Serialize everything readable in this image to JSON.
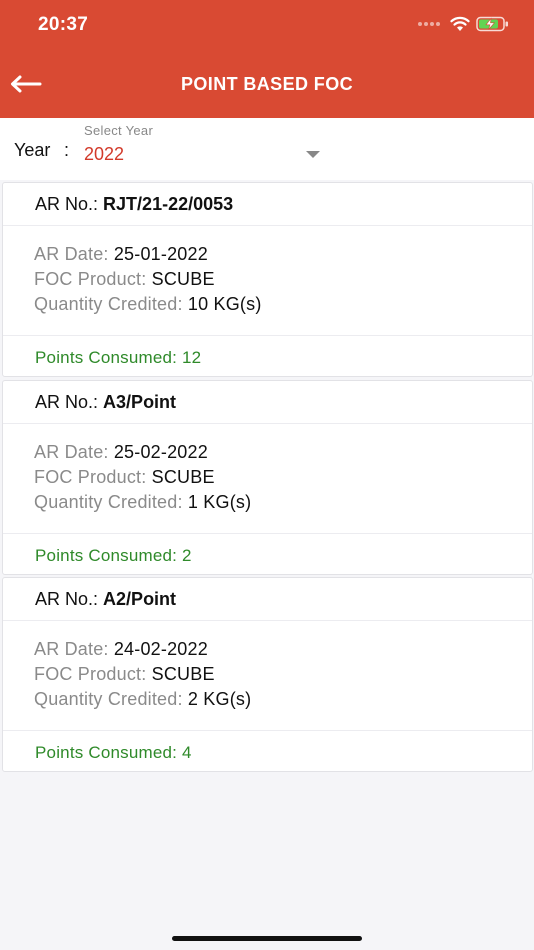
{
  "status_bar": {
    "time": "20:37"
  },
  "header": {
    "title": "POINT BASED FOC"
  },
  "year_filter": {
    "label": "Year",
    "colon": ":",
    "select_hint": "Select Year",
    "selected": "2022"
  },
  "labels": {
    "ar_no": "AR No.:",
    "ar_date": "AR Date:",
    "foc_product": "FOC Product:",
    "quantity_credited": "Quantity Credited:"
  },
  "records": [
    {
      "ar_no": "RJT/21-22/0053",
      "ar_date": "25-01-2022",
      "foc_product": "SCUBE",
      "quantity": "10 KG(s)",
      "points": "Points Consumed: 12"
    },
    {
      "ar_no": "A3/Point",
      "ar_date": "25-02-2022",
      "foc_product": "SCUBE",
      "quantity": "1 KG(s)",
      "points": "Points Consumed: 2"
    },
    {
      "ar_no": "A2/Point",
      "ar_date": "24-02-2022",
      "foc_product": "SCUBE",
      "quantity": "2 KG(s)",
      "points": "Points Consumed: 4"
    }
  ],
  "colors": {
    "header": "#d94a33",
    "selected_year": "#d23a2a",
    "points_text": "#2f8a2a",
    "label_text": "#8a8a8a"
  },
  "icons": [
    "back-arrow-icon",
    "wifi-icon",
    "battery-charging-icon",
    "signal-icon",
    "dropdown-caret-icon"
  ]
}
